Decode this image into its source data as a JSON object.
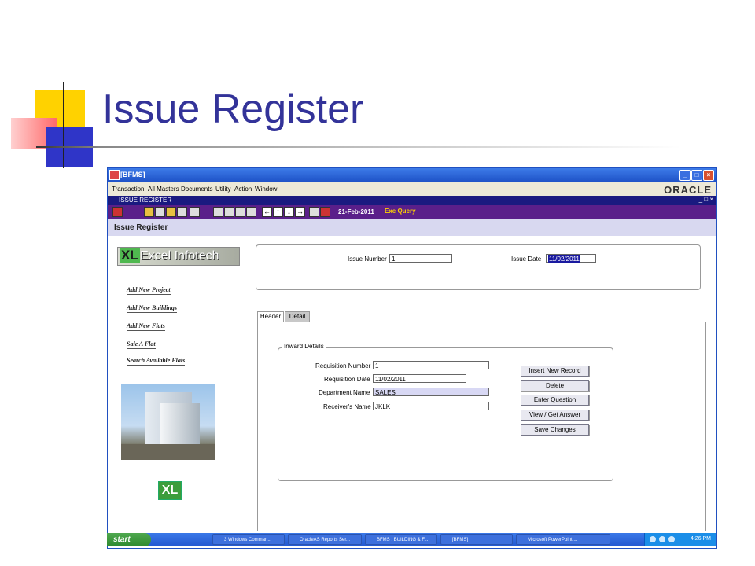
{
  "slide": {
    "title": "Issue Register"
  },
  "window": {
    "title": "[BFMS]",
    "menu": [
      "Transaction",
      "All Masters",
      "Documents",
      "Utility",
      "Action",
      "Window"
    ],
    "brand": "ORACLE",
    "sub_title": "ISSUE REGISTER",
    "toolbar_date": "21-Feb-2011",
    "toolbar_mode": "Exe Query",
    "form_title": "Issue Register"
  },
  "left_panel": {
    "logo_mark": "XL",
    "logo_name": "Excel Infotech",
    "links": [
      "Add New Project",
      "Add New Buildings",
      "Add New Flats",
      "Sale A Flat",
      "Search Available Flats"
    ],
    "small_logo": "XL"
  },
  "header_fields": {
    "issue_number_label": "Issue Number",
    "issue_number_value": "1",
    "issue_date_label": "Issue Date",
    "issue_date_value": "11/02/2011"
  },
  "tabs": [
    "Header",
    "Detail"
  ],
  "inward": {
    "title": "Inward  Details",
    "fields": [
      {
        "label": "Requisition Number",
        "value": "1"
      },
      {
        "label": "Requisition Date",
        "value": "11/02/2011"
      },
      {
        "label": "Department Name",
        "value": "SALES"
      },
      {
        "label": "Receiver's Name",
        "value": "JKLK"
      }
    ],
    "buttons": [
      "Insert New Record",
      "Delete",
      "Enter Question",
      "View / Get Answer",
      "Save Changes"
    ]
  },
  "taskbar": {
    "start": "start",
    "items": [
      "3 Windows Comman...",
      "OracleAS Reports Ser...",
      "BFMS : BUILDING & F...",
      "[BFMS]",
      "Microsoft PowerPoint ..."
    ],
    "clock": "4:26 PM"
  }
}
